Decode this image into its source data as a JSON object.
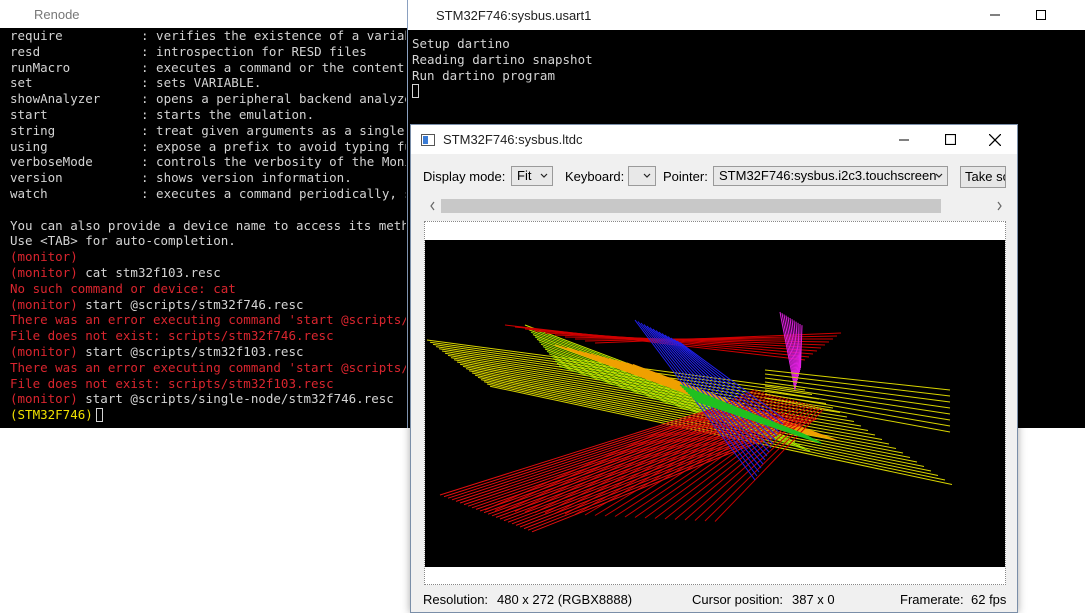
{
  "renode": {
    "title": "Renode",
    "help_rows": [
      {
        "cmd": "require",
        "desc": ": verifies the existence of a variab"
      },
      {
        "cmd": "resd",
        "desc": ": introspection for RESD files"
      },
      {
        "cmd": "runMacro",
        "desc": ": executes a command or the content o"
      },
      {
        "cmd": "set",
        "desc": ": sets VARIABLE."
      },
      {
        "cmd": "showAnalyzer",
        "desc": ": opens a peripheral backend analyzer"
      },
      {
        "cmd": "start",
        "desc": ": starts the emulation."
      },
      {
        "cmd": "string",
        "desc": ": treat given arguments as a single s"
      },
      {
        "cmd": "using",
        "desc": ": expose a prefix to avoid typing ful"
      },
      {
        "cmd": "verboseMode",
        "desc": ": controls the verbosity of the Monit"
      },
      {
        "cmd": "version",
        "desc": ": shows version information."
      },
      {
        "cmd": "watch",
        "desc": ": executes a command periodically, sh"
      }
    ],
    "hint1": "You can also provide a device name to access its method",
    "hint2": "Use <TAB> for auto-completion.",
    "log": [
      {
        "prompt": "(monitor)",
        "text": ""
      },
      {
        "prompt": "(monitor)",
        "text": " cat stm32f103.resc"
      },
      {
        "error": "No such command or device: cat"
      },
      {
        "prompt": "(monitor)",
        "text": " start @scripts/stm32f746.resc"
      },
      {
        "error": "There was an error executing command 'start @scripts/st"
      },
      {
        "error": "File does not exist: scripts/stm32f746.resc"
      },
      {
        "prompt": "(monitor)",
        "text": " start @scripts/stm32f103.resc"
      },
      {
        "error": "There was an error executing command 'start @scripts/st"
      },
      {
        "error": "File does not exist: scripts/stm32f103.resc"
      },
      {
        "prompt": "(monitor)",
        "text": " start @scripts/single-node/stm32f746.resc"
      }
    ],
    "current_prompt": "(STM32F746)"
  },
  "usart": {
    "title": "STM32F746:sysbus.usart1",
    "lines": [
      "Setup dartino",
      "Reading dartino snapshot",
      "Run dartino program"
    ]
  },
  "ltdc": {
    "title": "STM32F746:sysbus.ltdc",
    "display_mode_label": "Display mode:",
    "display_mode_value": "Fit",
    "keyboard_label": "Keyboard:",
    "keyboard_value": "",
    "pointer_label": "Pointer:",
    "pointer_value": "STM32F746:sysbus.i2c3.touchscreen",
    "screenshot_button": "Take scr",
    "resolution_label": "Resolution:",
    "resolution_value": "480 x 272 (RGBX8888)",
    "cursor_label": "Cursor position:",
    "cursor_value": "387 x 0",
    "framerate_label": "Framerate:",
    "framerate_value": "62 fps"
  },
  "colors": {
    "terminal_bg": "#000000",
    "terminal_fg": "#d4d4d4",
    "error_red": "#d9252e",
    "prompt_yellow": "#f0e000"
  },
  "icons": [
    "minimize-icon",
    "maximize-icon",
    "close-icon",
    "window-app-icon",
    "chevron-down-icon",
    "scroll-left-icon",
    "scroll-right-icon"
  ]
}
